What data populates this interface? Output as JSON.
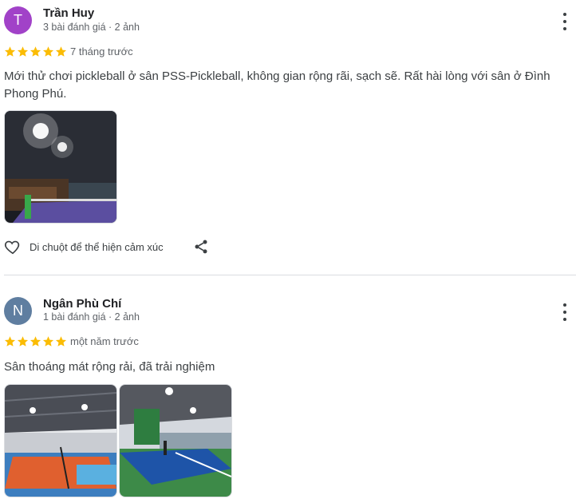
{
  "reviews": [
    {
      "avatar_letter": "T",
      "avatar_color": "#a142c8",
      "author": "Trần Huy",
      "stats": "3 bài đánh giá · 2 ảnh",
      "rating": 5,
      "time": "7 tháng trước",
      "text": "Mới thử chơi pickleball ở sân PSS-Pickleball, không gian rộng rãi, sạch sẽ. Rất hài lòng với sân ở Đình Phong Phú.",
      "photo_count": 1,
      "reaction_label": "Di chuột để thể hiện cảm xúc"
    },
    {
      "avatar_letter": "N",
      "avatar_color": "#5f7ea0",
      "author": "Ngân Phù Chí",
      "stats": "1 bài đánh giá · 2 ảnh",
      "rating": 5,
      "time": "một năm trước",
      "text": "Sân thoáng mát rộng rải, đã trải nghiệm",
      "photo_count": 2
    }
  ],
  "icons": {
    "star_color": "#fbbc04",
    "more": "more-vert-icon",
    "heart": "heart-outline-icon",
    "share": "share-icon"
  }
}
